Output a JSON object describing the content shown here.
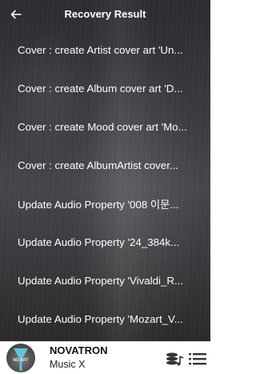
{
  "header": {
    "title": "Recovery Result",
    "back_icon": "arrow-left-icon"
  },
  "results": [
    "Cover : create Artist cover art 'Un...",
    "Cover : create Album cover art 'D...",
    "Cover : create Mood cover art 'Mo...",
    "Cover : create AlbumArtist cover...",
    "Update Audio Property '008 이문...",
    "Update Audio Property '24_384k...",
    "Update Audio Property 'Vivaldi_R...",
    "Update Audio Property 'Mozart_V..."
  ],
  "player": {
    "title": "NOVATRON",
    "subtitle": "Music X",
    "album_art_text": "NOVATRON",
    "queue_icon": "playlist-queue-icon",
    "menu_icon": "list-menu-icon"
  },
  "colors": {
    "text_light": "#ffffff",
    "player_bg": "#ffffff",
    "bg_dark": "#2b2d30"
  }
}
